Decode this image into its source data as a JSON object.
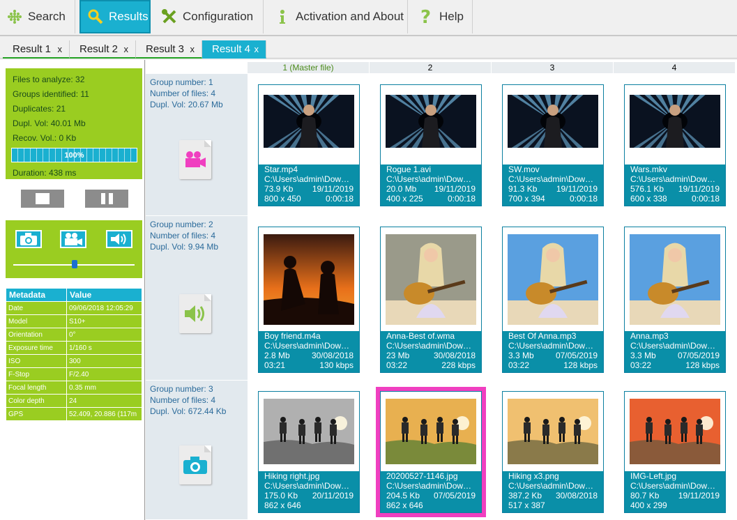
{
  "toolbar": {
    "items": [
      {
        "label": "Search",
        "icon": "grid-dots-icon"
      },
      {
        "label": "Results",
        "icon": "magnifier-icon"
      },
      {
        "label": "Configuration",
        "icon": "wrench-screwdriver-icon"
      },
      {
        "label": "Activation and About",
        "icon": "info-icon"
      },
      {
        "label": "Help",
        "icon": "question-icon"
      }
    ]
  },
  "tabs": [
    {
      "label": "Result 1",
      "close": "x"
    },
    {
      "label": "Result 2",
      "close": "x"
    },
    {
      "label": "Result 3",
      "close": "x"
    },
    {
      "label": "Result 4",
      "close": "x"
    }
  ],
  "stats": {
    "files": "Files to analyze: 32",
    "groups": "Groups identified: 11",
    "duplicates": "Duplicates: 21",
    "dupl_vol": "Dupl. Vol: 40.01 Mb",
    "recov_vol": "Recov. Vol.: 0 Kb",
    "progress_text": "100%",
    "progress": 1.0,
    "duration": "Duration: 438 ms"
  },
  "metadata": {
    "headers": [
      "Metadata",
      "Value"
    ],
    "rows": [
      [
        "Date",
        "09/06/2018 12:05:29"
      ],
      [
        "Model",
        "S10+"
      ],
      [
        "Orientation",
        "0°"
      ],
      [
        "Exposure time",
        "1/160 s"
      ],
      [
        "ISO",
        "300"
      ],
      [
        "F-Stop",
        "F/2.40"
      ],
      [
        "Focal length",
        "0.35 mm"
      ],
      [
        "Color depth",
        "24"
      ],
      [
        "GPS",
        "52.409, 20.886 (117m"
      ]
    ]
  },
  "columns": [
    "1 (Master file)",
    "2",
    "3",
    "4"
  ],
  "groups": [
    {
      "number": "Group number: 1",
      "files": "Number of files: 4",
      "vol": "Dupl. Vol: 20.67 Mb",
      "icon": "video-camera-icon",
      "cards": [
        {
          "name": "Star.mp4",
          "path": "C:\\Users\\admin\\Dow…",
          "size": "73.9 Kb",
          "date": "19/11/2019",
          "dim": "800 x 450",
          "extra": "0:00:18"
        },
        {
          "name": "Rogue 1.avi",
          "path": "C:\\Users\\admin\\Dow…",
          "size": "20.0 Mb",
          "date": "19/11/2019",
          "dim": "400 x 225",
          "extra": "0:00:18"
        },
        {
          "name": "SW.mov",
          "path": "C:\\Users\\admin\\Dow…",
          "size": "91.3 Kb",
          "date": "19/11/2019",
          "dim": "700 x 394",
          "extra": "0:00:18"
        },
        {
          "name": "Wars.mkv",
          "path": "C:\\Users\\admin\\Dow…",
          "size": "576.1 Kb",
          "date": "19/11/2019",
          "dim": "600 x 338",
          "extra": "0:00:18"
        }
      ]
    },
    {
      "number": "Group number: 2",
      "files": "Number of files: 4",
      "vol": "Dupl. Vol: 9.94 Mb",
      "icon": "speaker-icon",
      "cards": [
        {
          "name": "Boy friend.m4a",
          "path": "C:\\Users\\admin\\Dow…",
          "size": "2.8 Mb",
          "date": "30/08/2018",
          "dim": "03:21",
          "extra": "130 kbps"
        },
        {
          "name": "Anna-Best of.wma",
          "path": "C:\\Users\\admin\\Dow…",
          "size": "23 Mb",
          "date": "30/08/2018",
          "dim": "03:22",
          "extra": "228 kbps"
        },
        {
          "name": "Best Of Anna.mp3",
          "path": "C:\\Users\\admin\\Dow…",
          "size": "3.3 Mb",
          "date": "07/05/2019",
          "dim": "03:22",
          "extra": "128 kbps"
        },
        {
          "name": "Anna.mp3",
          "path": "C:\\Users\\admin\\Dow…",
          "size": "3.3 Mb",
          "date": "07/05/2019",
          "dim": "03:22",
          "extra": "128 kbps"
        }
      ]
    },
    {
      "number": "Group number: 3",
      "files": "Number of files: 4",
      "vol": "Dupl. Vol: 672.44 Kb",
      "icon": "camera-icon",
      "cards": [
        {
          "name": "Hiking right.jpg",
          "path": "C:\\Users\\admin\\Dow…",
          "size": "175.0 Kb",
          "date": "20/11/2019",
          "dim": "862 x 646",
          "extra": ""
        },
        {
          "name": "20200527-1146.jpg",
          "path": "C:\\Users\\admin\\Dow…",
          "size": "204.5 Kb",
          "date": "07/05/2019",
          "dim": "862 x 646",
          "extra": ""
        },
        {
          "name": "Hiking x3.png",
          "path": "C:\\Users\\admin\\Dow…",
          "size": "387.2 Kb",
          "date": "30/08/2018",
          "dim": "517 x 387",
          "extra": ""
        },
        {
          "name": "IMG-Left.jpg",
          "path": "C:\\Users\\admin\\Dow…",
          "size": "80.7 Kb",
          "date": "19/11/2019",
          "dim": "400 x 299",
          "extra": ""
        }
      ]
    }
  ],
  "colors": {
    "accent": "#1ab0d0",
    "panel": "#9acd21",
    "card": "#0a8fa8",
    "selection": "#f03fc0"
  }
}
